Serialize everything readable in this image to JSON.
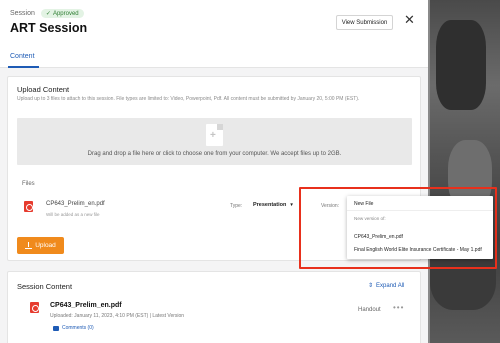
{
  "header": {
    "overline": "Session",
    "badge": "Approved",
    "title": "ART Session",
    "view_button": "View Submission",
    "close": "✕"
  },
  "tabs": [
    {
      "label": "Content"
    }
  ],
  "upload": {
    "title": "Upload Content",
    "subtitle": "Upload up to 3 files to attach to this session. File types are limited to: Video, Powerpoint, Pdf. All content must be submitted by January 20, 5:00 PM (EST).",
    "dropzone_text": "Drag and drop a file here or click to choose one from your computer. We accept files up to 2GB.",
    "files_label": "Files",
    "file": {
      "name": "CP643_Prelim_en.pdf",
      "note": "Will be added as a new file",
      "type_label": "Type:",
      "type_value": "Presentation",
      "version_label": "Version:"
    },
    "upload_button": "Upload"
  },
  "version_menu": {
    "new_file": "New File",
    "new_version_header": "New version of:",
    "options": [
      "CP643_Prelim_en.pdf",
      "Final English World Elite Insurance Certificate - May 1.pdf"
    ]
  },
  "session_content": {
    "title": "Session Content",
    "expand_all": "Expand All",
    "item": {
      "name": "CP643_Prelim_en.pdf",
      "meta": "Uploaded: January 11, 2023, 4:10 PM (EST)  |  Latest Version",
      "comments": "Comments (0)",
      "tag": "Handout",
      "more": "•••"
    }
  },
  "colors": {
    "accent": "#1e5bb5",
    "upload_button": "#f08a1c",
    "highlight": "#e8301c",
    "pdf": "#e63b2e"
  }
}
